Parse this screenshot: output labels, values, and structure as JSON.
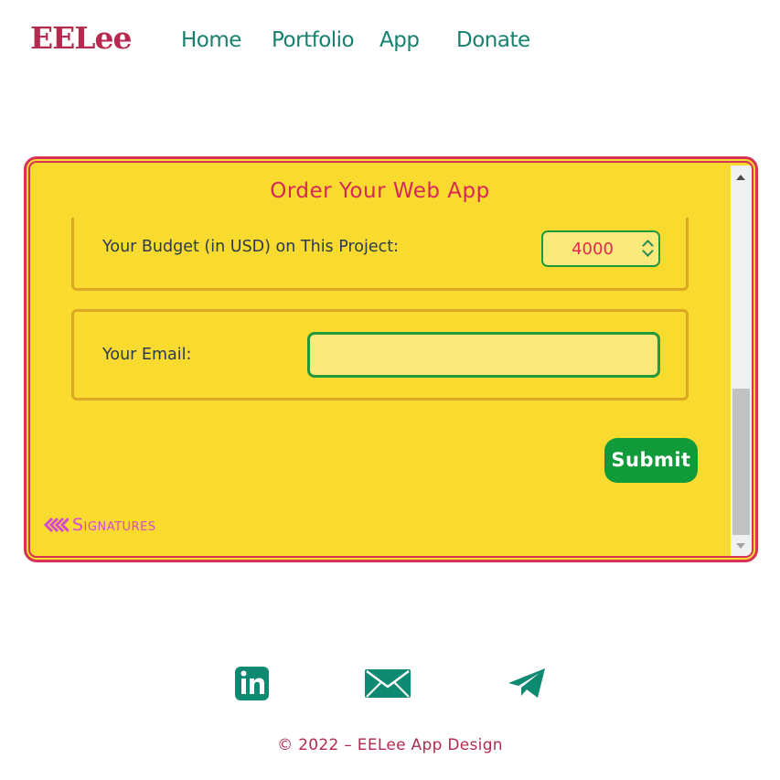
{
  "header": {
    "logo": "EELee",
    "nav": [
      {
        "label": "Home"
      },
      {
        "label": "Portfolio"
      },
      {
        "label": "App"
      },
      {
        "label": "Donate"
      }
    ]
  },
  "form": {
    "title": "Order Your Web App",
    "budget": {
      "label": "Your Budget (in USD) on This Project:",
      "value": "4000"
    },
    "email": {
      "label": "Your Email:",
      "value": ""
    },
    "submit_label": "Submit",
    "signatures_link": "Signatures"
  },
  "social": [
    {
      "icon": "linkedin-icon"
    },
    {
      "icon": "email-icon"
    },
    {
      "icon": "telegram-icon"
    }
  ],
  "footer": "© 2022 – EELee App Design",
  "colors": {
    "brand": "#b52a4e",
    "nav": "#17806e",
    "panel": "#f9db2f",
    "panel_border": "#d63355",
    "submit": "#119a3a",
    "social": "#0f8a72",
    "signatures_link": "#d34bd0"
  }
}
